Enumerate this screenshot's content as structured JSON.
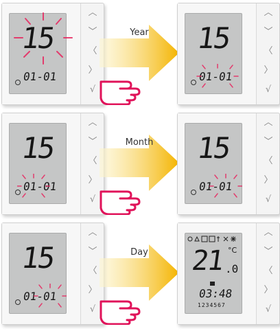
{
  "steps": [
    {
      "label": "Year",
      "value": "15",
      "date": "01-01"
    },
    {
      "label": "Month",
      "value": "15",
      "date": "01-01"
    },
    {
      "label": "Day",
      "value": "15",
      "date": "01-01"
    }
  ],
  "final_screen": {
    "temperature": "21",
    "decimal": ".0",
    "unit": "°C",
    "clock": "03:48",
    "days": "1234567"
  },
  "buttons": {
    "up": "︿",
    "down": "﹀",
    "left": "〈",
    "right": "〉",
    "ok": "√"
  },
  "colors": {
    "highlight": "#e8245e",
    "arrow_start": "#fdf6d2",
    "arrow_end": "#f4b400",
    "hand": "#e0135a"
  },
  "icons": {
    "hand": "pointing-hand-icon",
    "arrow": "right-arrow-icon",
    "ok": "check-o-icon"
  }
}
